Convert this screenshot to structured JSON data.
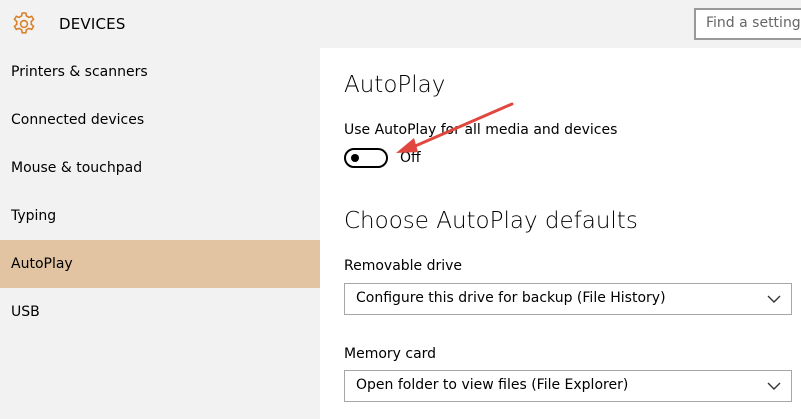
{
  "header": {
    "title": "DEVICES",
    "search_placeholder": "Find a setting"
  },
  "sidebar": {
    "items": [
      {
        "label": "Printers & scanners"
      },
      {
        "label": "Connected devices"
      },
      {
        "label": "Mouse & touchpad"
      },
      {
        "label": "Typing"
      },
      {
        "label": "AutoPlay",
        "active": true
      },
      {
        "label": "USB"
      }
    ]
  },
  "main": {
    "title": "AutoPlay",
    "toggle_label": "Use AutoPlay for all media and devices",
    "toggle_state": "Off",
    "defaults_title": "Choose AutoPlay defaults",
    "removable": {
      "label": "Removable drive",
      "value": "Configure this drive for backup (File History)"
    },
    "memory": {
      "label": "Memory card",
      "value": "Open folder to view files (File Explorer)"
    }
  },
  "colors": {
    "accent_selected": "#e2c4a2",
    "gear": "#d9822b",
    "annotation_arrow": "#e0473f"
  },
  "icons": {
    "settings": "gear-icon",
    "dropdown": "chevron-down-icon"
  }
}
